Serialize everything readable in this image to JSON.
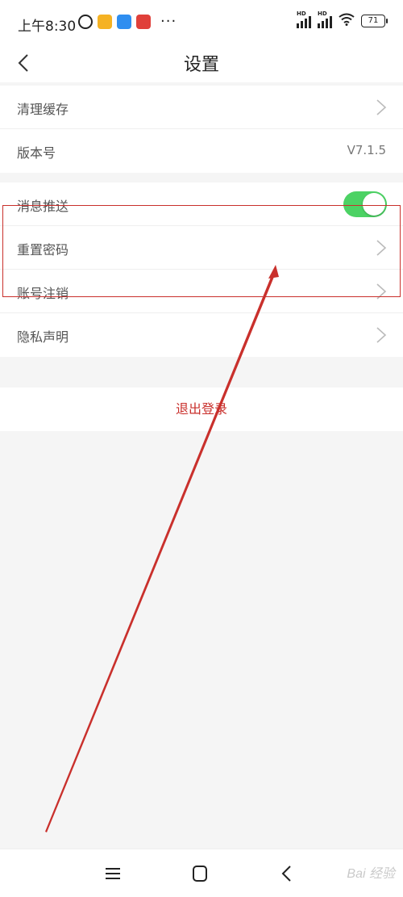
{
  "status_bar": {
    "time": "上午8:30",
    "signal_label_1": "HD",
    "signal_label_2": "HD",
    "battery": "71",
    "more": "···"
  },
  "header": {
    "title": "设置"
  },
  "group1": {
    "items": [
      {
        "label": "清理缓存"
      },
      {
        "label": "版本号",
        "value": "V7.1.5"
      }
    ]
  },
  "group2": {
    "items": [
      {
        "label": "消息推送",
        "toggle_on": true
      },
      {
        "label": "重置密码"
      },
      {
        "label": "账号注销"
      },
      {
        "label": "隐私声明"
      }
    ]
  },
  "logout": {
    "label": "退出登录",
    "color": "#c9302c"
  },
  "colors": {
    "toggle_on": "#4cd264",
    "annotation": "#c9302c",
    "background": "#f5f5f5"
  },
  "navbar": {
    "watermark": "Bai 经验",
    "icons": [
      "menu-icon",
      "home-square-icon",
      "back-icon"
    ]
  }
}
